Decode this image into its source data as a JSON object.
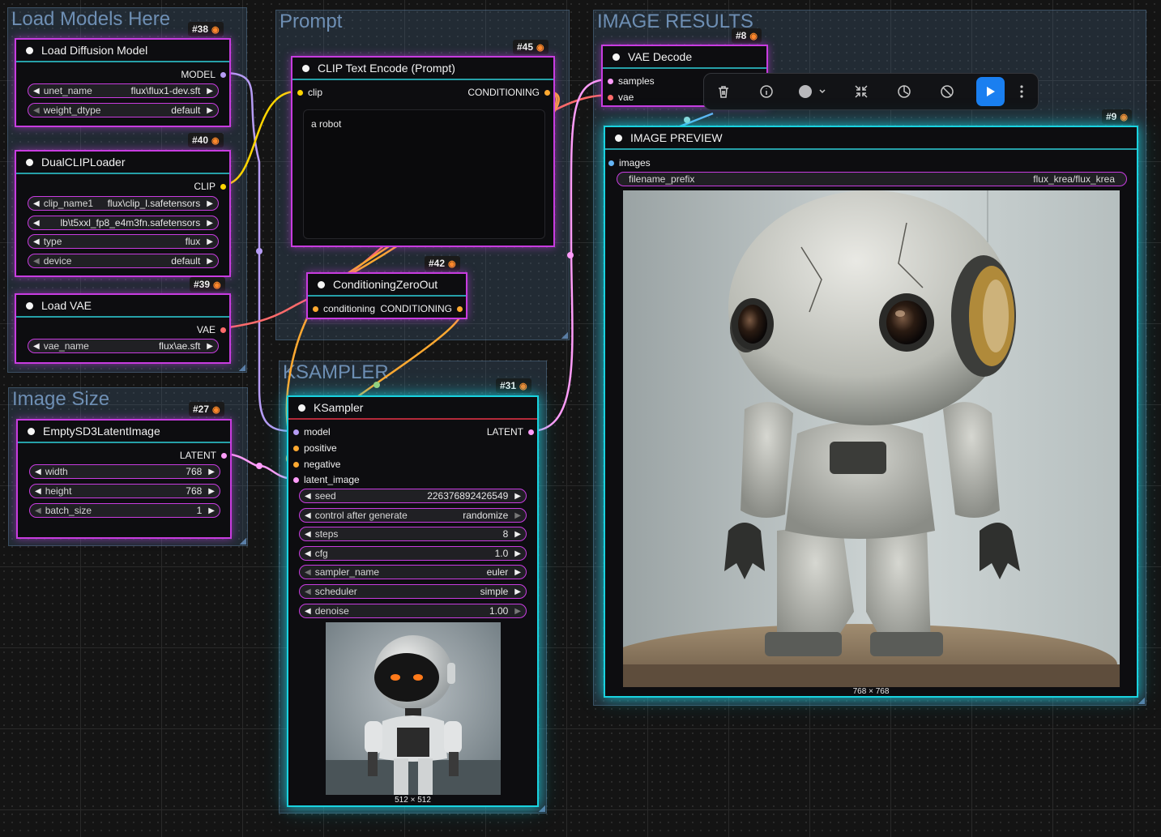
{
  "groups": {
    "load_models": "Load Models Here",
    "prompt": "Prompt",
    "image_results": "IMAGE RESULTS",
    "image_size": "Image Size",
    "ksampler": "KSAMPLER"
  },
  "nodes": {
    "load_diffusion": {
      "id": "#38",
      "title": "Load Diffusion Model",
      "output": "MODEL",
      "widgets": [
        {
          "label": "unet_name",
          "value": "flux\\flux1-dev.sft"
        },
        {
          "label": "weight_dtype",
          "value": "default"
        }
      ]
    },
    "dual_clip": {
      "id": "#40",
      "title": "DualCLIPLoader",
      "output": "CLIP",
      "widgets": [
        {
          "label": "clip_name1",
          "value": "flux\\clip_l.safetensors"
        },
        {
          "label": "",
          "value": "lb\\t5xxl_fp8_e4m3fn.safetensors"
        },
        {
          "label": "type",
          "value": "flux"
        },
        {
          "label": "device",
          "value": "default"
        }
      ]
    },
    "load_vae": {
      "id": "#39",
      "title": "Load VAE",
      "output": "VAE",
      "widgets": [
        {
          "label": "vae_name",
          "value": "flux\\ae.sft"
        }
      ]
    },
    "empty_latent": {
      "id": "#27",
      "title": "EmptySD3LatentImage",
      "output": "LATENT",
      "widgets": [
        {
          "label": "width",
          "value": "768"
        },
        {
          "label": "height",
          "value": "768"
        },
        {
          "label": "batch_size",
          "value": "1"
        }
      ]
    },
    "clip_encode": {
      "id": "#45",
      "title": "CLIP Text Encode (Prompt)",
      "input": "clip",
      "output": "CONDITIONING",
      "text": "a robot"
    },
    "cond_zero": {
      "id": "#42",
      "title": "ConditioningZeroOut",
      "input": "conditioning",
      "output": "CONDITIONING"
    },
    "ksampler": {
      "id": "#31",
      "title": "KSampler",
      "inputs": [
        "model",
        "positive",
        "negative",
        "latent_image"
      ],
      "output": "LATENT",
      "widgets": [
        {
          "label": "seed",
          "value": "226376892426549"
        },
        {
          "label": "control after generate",
          "value": "randomize"
        },
        {
          "label": "steps",
          "value": "8"
        },
        {
          "label": "cfg",
          "value": "1.0"
        },
        {
          "label": "sampler_name",
          "value": "euler"
        },
        {
          "label": "scheduler",
          "value": "simple"
        },
        {
          "label": "denoise",
          "value": "1.00"
        }
      ],
      "preview_caption": "512 × 512"
    },
    "vae_decode": {
      "id": "#8",
      "title": "VAE Decode",
      "inputs": [
        "samples",
        "vae"
      ]
    },
    "image_preview": {
      "id": "#9",
      "title": "IMAGE PREVIEW",
      "input": "images",
      "filename_prefix_label": "filename_prefix",
      "filename_prefix_value": "flux_krea/flux_krea",
      "caption": "768 × 768"
    }
  },
  "toolbar": {
    "icons": [
      "trash-icon",
      "info-icon",
      "color-circle-icon",
      "collapse-icon",
      "bypass-icon",
      "mute-icon",
      "run-icon",
      "more-icon"
    ]
  },
  "colors": {
    "node_border": "#c83ce0",
    "selected_border": "#19d3e0",
    "model": "#b69cf4",
    "clip": "#ffd500",
    "vae": "#ff6b6b",
    "latent": "#ff9cf9",
    "conditioning": "#ffa931",
    "image": "#64b5f6"
  }
}
